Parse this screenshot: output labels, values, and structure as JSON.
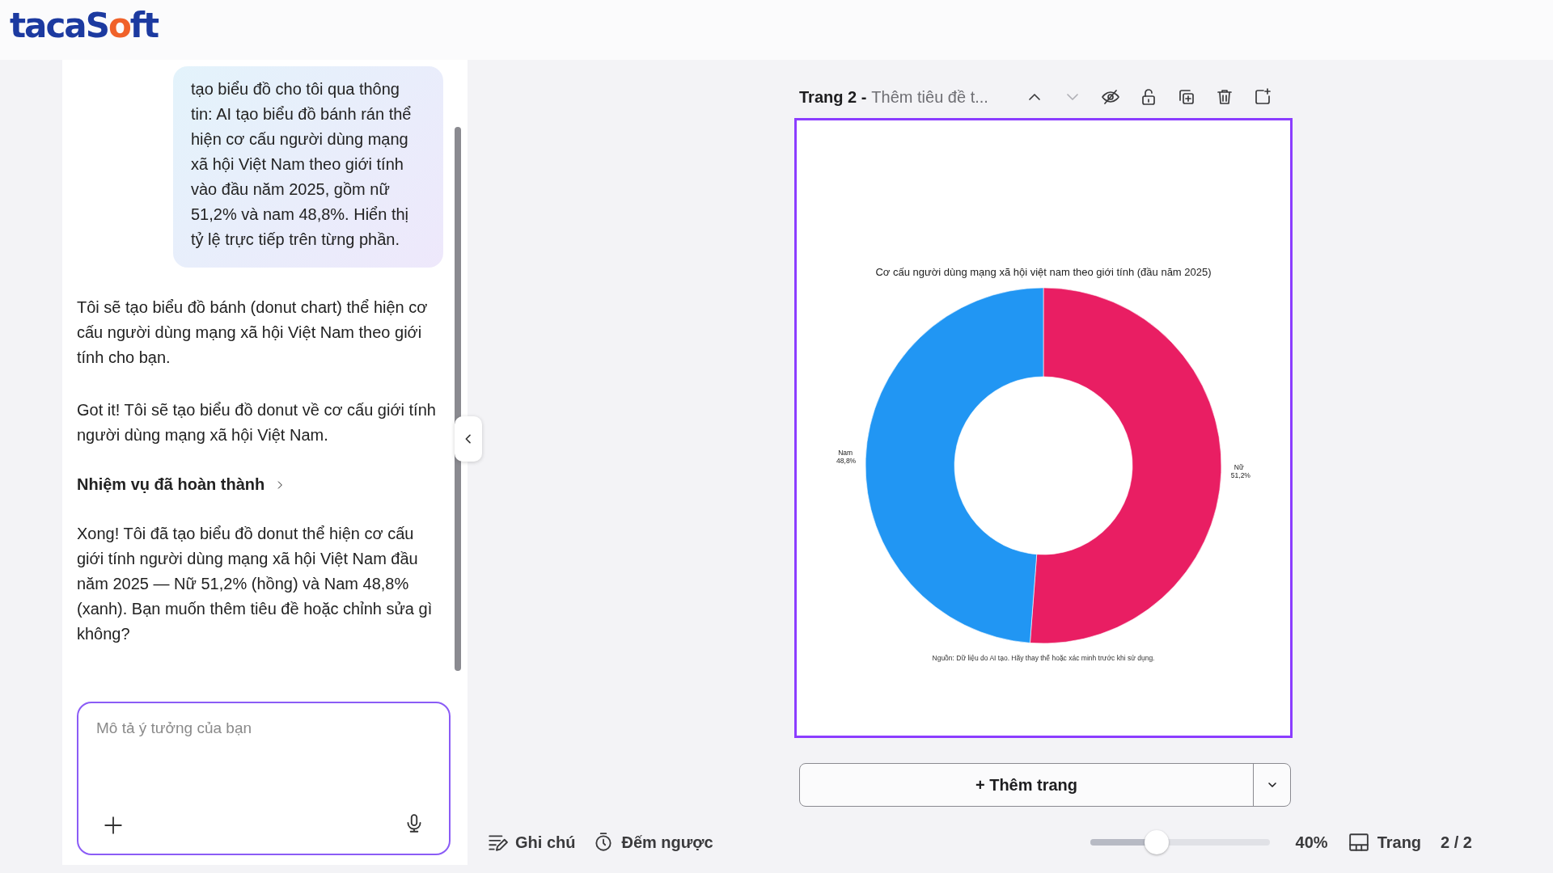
{
  "logo": {
    "text": "tacaSoft"
  },
  "chat": {
    "messages": [
      {
        "kind": "user",
        "text": "tạo biểu đồ cho tôi qua thông tin: AI tạo biểu đồ bánh rán thể hiện cơ cấu người dùng mạng xã hội Việt Nam theo giới tính vào đầu năm 2025, gồm nữ 51,2% và nam 48,8%. Hiển thị tỷ lệ trực tiếp trên từng phần."
      },
      {
        "kind": "assistant",
        "text": "Tôi sẽ tạo biểu đồ bánh (donut chart) thể hiện cơ cấu người dùng mạng xã hội Việt Nam theo giới tính cho bạn."
      },
      {
        "kind": "assistant",
        "text": "Got it! Tôi sẽ tạo biểu đồ donut về cơ cấu giới tính người dùng mạng xã hội Việt Nam."
      },
      {
        "kind": "task",
        "text": "Nhiệm vụ đã hoàn thành"
      },
      {
        "kind": "assistant",
        "text": "Xong! Tôi đã tạo biểu đồ donut thể hiện cơ cấu giới tính người dùng mạng xã hội Việt Nam đầu năm 2025 — Nữ 51,2% (hồng) và Nam 48,8% (xanh). Bạn muốn thêm tiêu đề hoặc chỉnh sửa gì không?"
      }
    ],
    "input": {
      "placeholder": "Mô tả ý tưởng của bạn"
    }
  },
  "page_header": {
    "page_label": "Trang 2 -",
    "title": "Thêm tiêu đề t...",
    "actions": [
      {
        "kind": "up",
        "disabled": false
      },
      {
        "kind": "down",
        "disabled": true
      },
      {
        "kind": "hide",
        "disabled": false
      },
      {
        "kind": "lock",
        "disabled": false
      },
      {
        "kind": "duplicate",
        "disabled": false
      },
      {
        "kind": "delete",
        "disabled": false
      },
      {
        "kind": "add",
        "disabled": false
      }
    ]
  },
  "canvas": {
    "selected": true,
    "chart_data": {
      "type": "donut",
      "title": "Cơ cấu người dùng mạng xã hội việt nam theo giới tính (đầu năm 2025)",
      "categories": [
        "Nữ",
        "Nam"
      ],
      "values": [
        51.2,
        48.8
      ],
      "colors": [
        "#e91e63",
        "#2196f3"
      ],
      "value_labels": [
        "51,2%",
        "48,8%"
      ]
    },
    "source": "Nguồn: Dữ liệu do AI tạo. Hãy thay thế hoặc xác minh trước khi sử dụng."
  },
  "add_page": {
    "label": "+ Thêm trang"
  },
  "bottom_bar": {
    "notes": "Ghi chú",
    "countdown": "Đếm ngược",
    "zoom": {
      "level": 0.37,
      "reading": "40%"
    },
    "pages_label": "Trang",
    "page_count": "2 / 2"
  }
}
